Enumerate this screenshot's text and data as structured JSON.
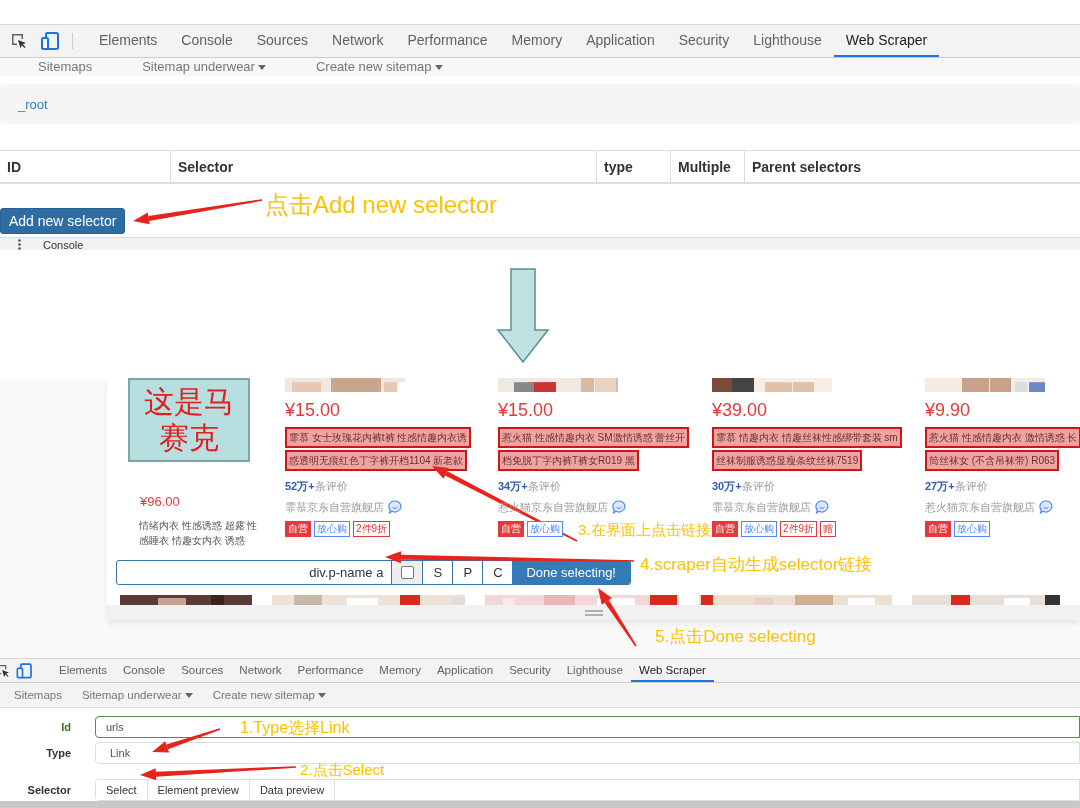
{
  "devtools_top": {
    "tabs": [
      {
        "label": "Elements",
        "selected": false
      },
      {
        "label": "Console",
        "selected": false
      },
      {
        "label": "Sources",
        "selected": false
      },
      {
        "label": "Network",
        "selected": false
      },
      {
        "label": "Performance",
        "selected": false
      },
      {
        "label": "Memory",
        "selected": false
      },
      {
        "label": "Application",
        "selected": false
      },
      {
        "label": "Security",
        "selected": false
      },
      {
        "label": "Lighthouse",
        "selected": false
      },
      {
        "label": "Web Scraper",
        "selected": true
      }
    ],
    "subnav": [
      {
        "label": "Sitemaps",
        "dropdown": false
      },
      {
        "label": "Sitemap underwear",
        "dropdown": true
      },
      {
        "label": "Create new sitemap",
        "dropdown": true
      }
    ],
    "breadcrumb": "_root",
    "table": {
      "columns": [
        "ID",
        "Selector",
        "type",
        "Multiple",
        "Parent selectors"
      ]
    },
    "add_button": "Add new selector",
    "drawer": "Console"
  },
  "page": {
    "mosaic_label": "这是马赛克",
    "featured": {
      "price": "¥96.00",
      "description": "情绪内衣 性感诱惑 超露 性感睡衣 情趣女内衣 诱惑"
    },
    "products": [
      {
        "price": "¥15.00",
        "title_lines": [
          "霏慕 女士玫瑰花内裤t裤 性感情趣内衣诱",
          "惑透明无痕红色丁字裤开档1104 新老款"
        ],
        "highlighted": true,
        "review_count": "52万+",
        "review_suffix": "条评价",
        "shop": "霏慕京东自营旗舰店",
        "tags": [
          {
            "label": "自营",
            "kind": "self"
          },
          {
            "label": "放心购",
            "kind": "assured"
          },
          {
            "label": "2件9折",
            "kind": "promo"
          }
        ]
      },
      {
        "price": "¥15.00",
        "title_lines": [
          "惹火猫 性感情趣内衣 SM激情诱惑 蕾丝开",
          "档免脱丁字内裤T裤女R019 黑"
        ],
        "highlighted": true,
        "review_count": "34万+",
        "review_suffix": "条评价",
        "shop": "惹火猫京东自营旗舰店",
        "tags": [
          {
            "label": "自营",
            "kind": "self"
          },
          {
            "label": "放心购",
            "kind": "assured"
          }
        ]
      },
      {
        "price": "¥39.00",
        "title_lines": [
          "霏慕 情趣内衣 情趣丝袜性感绑带套装 sm",
          "丝袜制服诱惑显瘦条纹丝袜7519"
        ],
        "highlighted": true,
        "review_count": "30万+",
        "review_suffix": "条评价",
        "shop": "霏慕京东自营旗舰店",
        "tags": [
          {
            "label": "自营",
            "kind": "self"
          },
          {
            "label": "放心购",
            "kind": "assured"
          },
          {
            "label": "2件9折",
            "kind": "promo"
          },
          {
            "label": "赠",
            "kind": "promo"
          }
        ]
      },
      {
        "price": "¥9.90",
        "title_lines": [
          "惹火猫 性感情趣内衣 激情诱惑 长",
          "筒丝袜女 (不含吊袜带) R063"
        ],
        "highlighted": true,
        "review_count": "27万+",
        "review_suffix": "条评价",
        "shop": "惹火猫京东自营旗舰店",
        "tags": [
          {
            "label": "自营",
            "kind": "self"
          },
          {
            "label": "放心购",
            "kind": "assured"
          }
        ]
      }
    ],
    "selector_bar": {
      "value": "div.p-name a",
      "checked": false,
      "buttons": [
        "S",
        "P",
        "C"
      ],
      "done_button": "Done selecting!"
    }
  },
  "devtools_bottom": {
    "tabs": [
      {
        "label": "Elements",
        "selected": false
      },
      {
        "label": "Console",
        "selected": false
      },
      {
        "label": "Sources",
        "selected": false
      },
      {
        "label": "Network",
        "selected": false
      },
      {
        "label": "Performance",
        "selected": false
      },
      {
        "label": "Memory",
        "selected": false
      },
      {
        "label": "Application",
        "selected": false
      },
      {
        "label": "Security",
        "selected": false
      },
      {
        "label": "Lighthouse",
        "selected": false
      },
      {
        "label": "Web Scraper",
        "selected": true
      }
    ],
    "subnav": [
      {
        "label": "Sitemaps",
        "dropdown": false
      },
      {
        "label": "Sitemap underwear",
        "dropdown": true
      },
      {
        "label": "Create new sitemap",
        "dropdown": true
      }
    ],
    "form": [
      {
        "kind": "text",
        "label": "Id",
        "value": "urls",
        "valid": true
      },
      {
        "kind": "select",
        "label": "Type",
        "value": "Link",
        "valid": false
      },
      {
        "kind": "buttons",
        "label": "Selector",
        "buttons": [
          "Select",
          "Element preview",
          "Data preview"
        ],
        "valid": false
      }
    ]
  },
  "annotations": [
    {
      "text": "点击Add new selector"
    },
    {
      "text": "3.在界面上点击链接"
    },
    {
      "text": "4.scraper自动生成selector链接"
    },
    {
      "text": "5.点击Done selecting"
    },
    {
      "text": "1.Type选择Link"
    },
    {
      "text": "2.点击Select"
    }
  ]
}
